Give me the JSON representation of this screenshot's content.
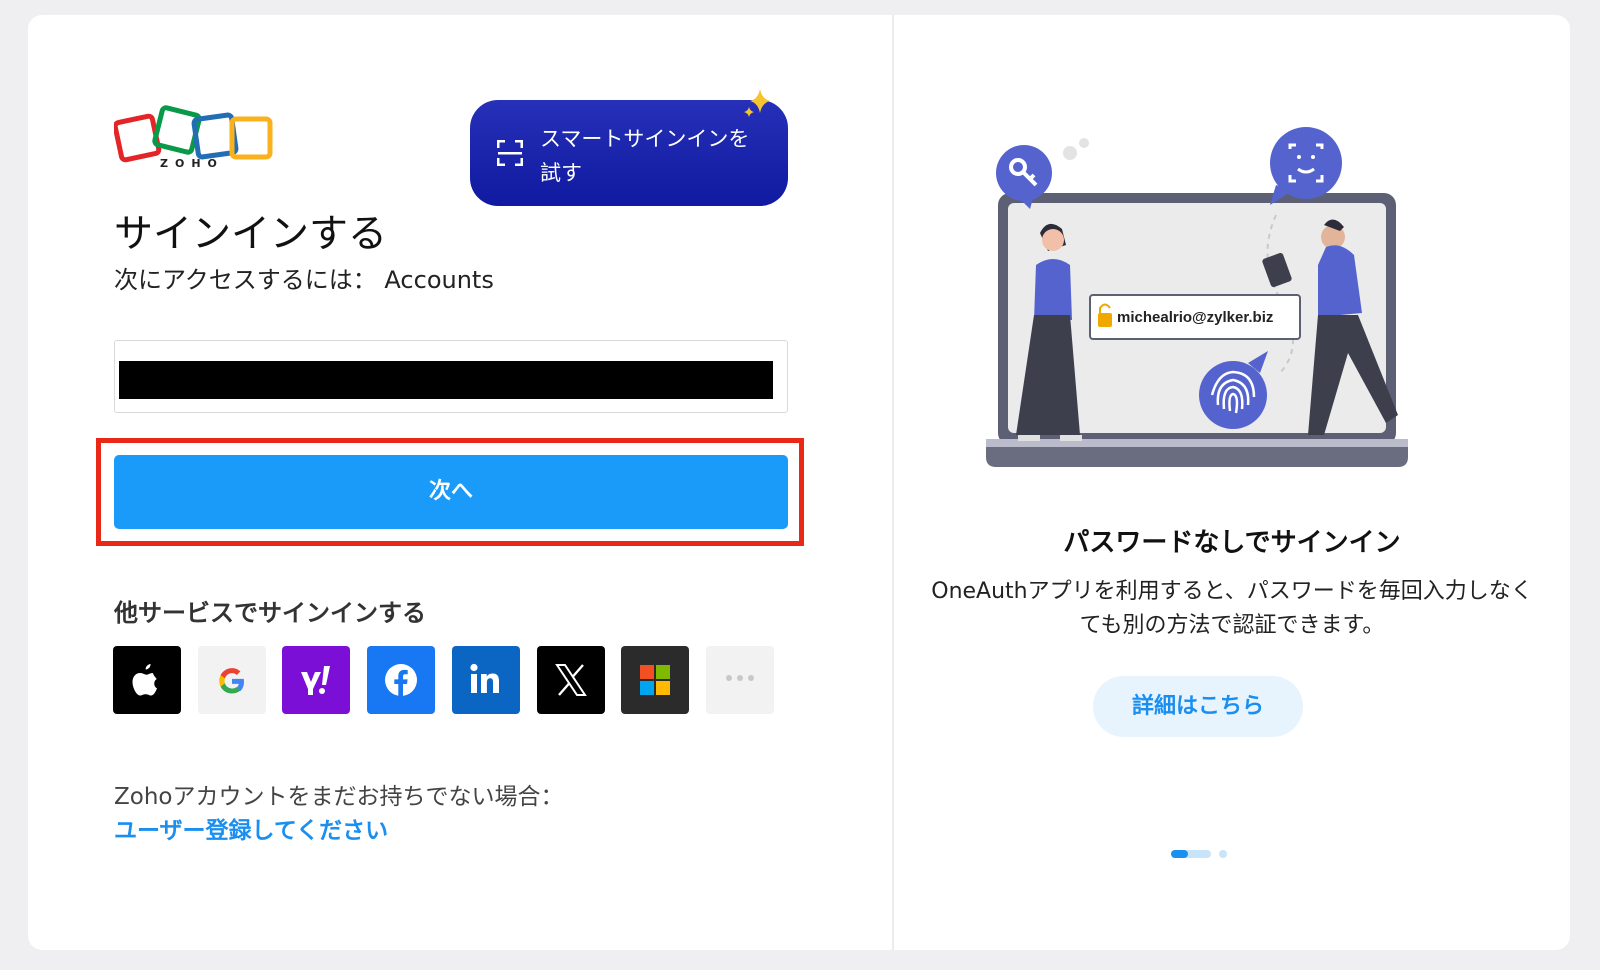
{
  "brand": {
    "logo_text": "ZOHO"
  },
  "smart_signin": {
    "label": "スマートサインインを試す"
  },
  "signin": {
    "title": "サインインする",
    "subtitle": "次にアクセスするには： Accounts"
  },
  "login_field": {
    "value": "",
    "placeholder": ""
  },
  "next_button": {
    "label": "次へ"
  },
  "other_services": {
    "title": "他サービスでサインインする",
    "providers": [
      "apple-icon",
      "google-icon",
      "yahoo-icon",
      "facebook-icon",
      "linkedin-icon",
      "x-icon",
      "microsoft-icon",
      "more-icon"
    ]
  },
  "signup": {
    "prompt": "Zohoアカウントをまだお持ちでない場合：",
    "link": "ユーザー登録してください"
  },
  "promo": {
    "email_label": "michealrio@zylker.biz",
    "title": "パスワードなしでサインイン",
    "description": "OneAuthアプリを利用すると、パスワードを毎回入力しなくても別の方法で認証できます。",
    "more_button": "詳細はこちら",
    "carousel": {
      "current": 1,
      "total": 2
    }
  },
  "colors": {
    "primary": "#1a9bfa",
    "smart_button": "#1c26ad",
    "highlight": "#ea2817",
    "link": "#1a8ff0"
  }
}
